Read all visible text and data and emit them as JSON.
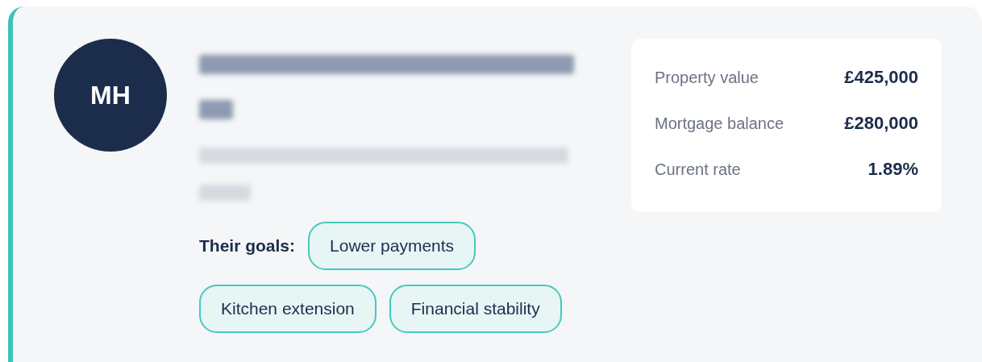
{
  "client": {
    "initials": "MH"
  },
  "goals": {
    "label": "Their goals:",
    "items": [
      "Lower payments",
      "Kitchen extension",
      "Financial stability"
    ]
  },
  "stats": [
    {
      "label": "Property value",
      "value": "£425,000"
    },
    {
      "label": "Mortgage balance",
      "value": "£280,000"
    },
    {
      "label": "Current rate",
      "value": "1.89%"
    }
  ]
}
